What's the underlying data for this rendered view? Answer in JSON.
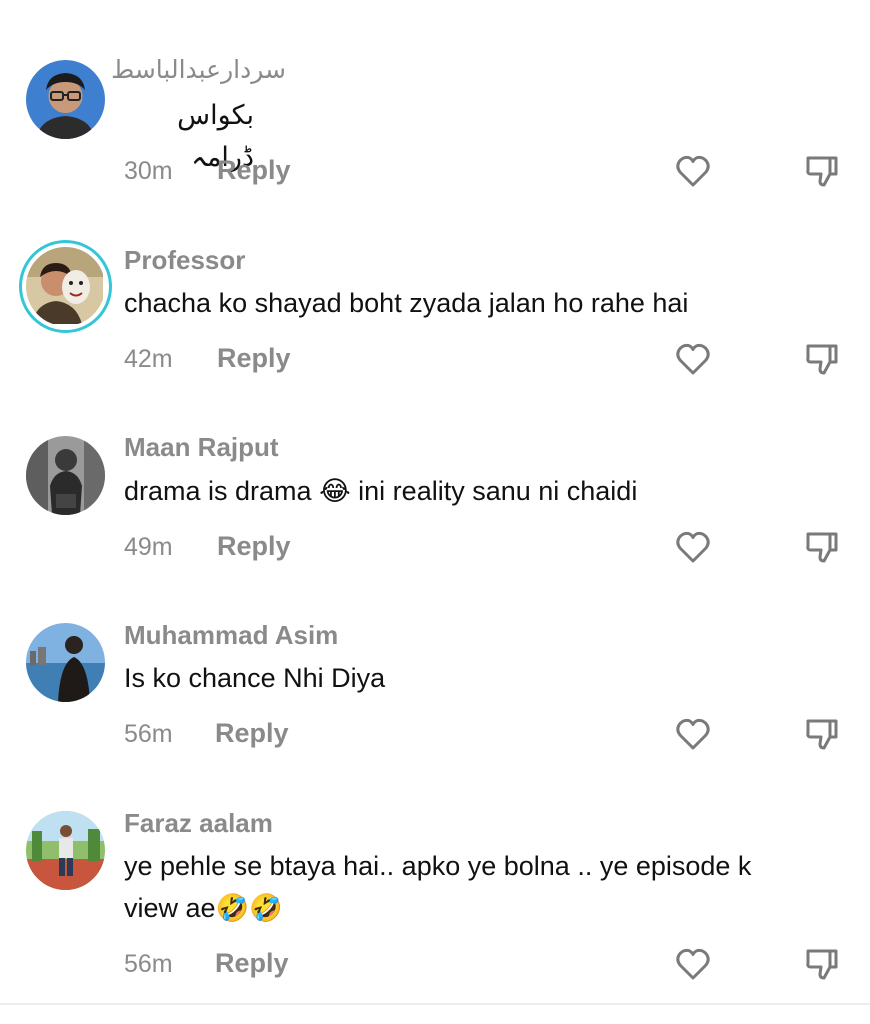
{
  "comments": [
    {
      "username": "سردارعبدالباسط",
      "text": "بکواس ڈرامہ",
      "time": "30m",
      "reply_label": "Reply"
    },
    {
      "username": "Professor",
      "text": "chacha ko shayad boht zyada jalan ho rahe hai",
      "time": "42m",
      "reply_label": "Reply"
    },
    {
      "username": "Maan Rajput",
      "text_before": "drama is drama",
      "emoji": "😂",
      "text_after": "ini reality sanu ni chaidi",
      "time": "49m",
      "reply_label": "Reply"
    },
    {
      "username": "Muhammad Asim",
      "text": "Is ko chance Nhi Diya",
      "time": "56m",
      "reply_label": "Reply"
    },
    {
      "username": "Faraz aalam",
      "text_line1": "ye pehle se btaya hai.. apko ye bolna .. ye episode k",
      "text_line2": "view ae",
      "emoji": "🤣🤣",
      "time": "56m",
      "reply_label": "Reply"
    }
  ],
  "icons": {
    "like": "heart-outline-icon",
    "dislike": "thumbs-down-outline-icon"
  },
  "colors": {
    "muted_text": "#8a8a8a",
    "body_text": "#111111",
    "story_ring": "#35c6d6"
  }
}
